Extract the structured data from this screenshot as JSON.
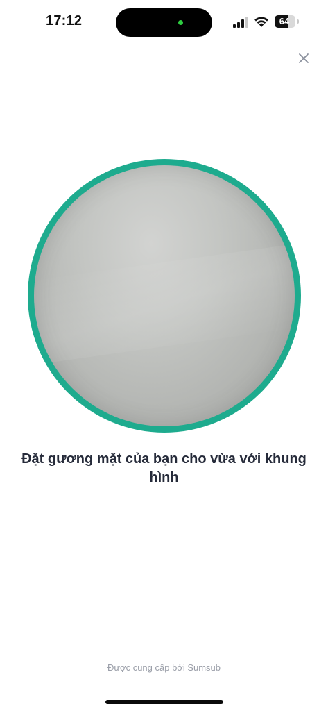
{
  "status_bar": {
    "time": "17:12",
    "battery_level": "64",
    "battery_fraction": 0.64,
    "icons": [
      "signal-icon",
      "wifi-icon",
      "battery-icon"
    ]
  },
  "header": {
    "close_icon": "close-icon"
  },
  "camera": {
    "ring_color": "#1eab8e"
  },
  "instruction": {
    "text": "Đặt gương mặt của bạn cho vừa với khung hình"
  },
  "footer": {
    "powered_by": "Được cung cấp bởi Sumsub"
  },
  "colors": {
    "accent": "#1eab8e",
    "text_primary": "#262b3a",
    "text_secondary": "#9a9ea8"
  }
}
